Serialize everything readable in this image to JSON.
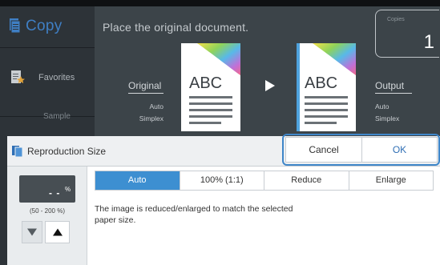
{
  "app": {
    "title": "Copy",
    "favorites_label": "Favorites",
    "sample_label": "Sample"
  },
  "header": {
    "message": "Place the original document."
  },
  "copies": {
    "label": "Copies",
    "value": "1"
  },
  "original": {
    "label": "Original",
    "lines": [
      "Auto",
      "Simplex"
    ],
    "doc_text": "ABC"
  },
  "output": {
    "label": "Output",
    "lines": [
      "Auto",
      "Simplex"
    ],
    "doc_text": "ABC"
  },
  "dialog": {
    "title": "Reproduction Size",
    "cancel_label": "Cancel",
    "ok_label": "OK",
    "percent_value": "- -",
    "percent_unit": "%",
    "range_text": "(50 - 200 %)",
    "tabs": [
      {
        "label": "Auto",
        "active": true
      },
      {
        "label": "100% (1:1)",
        "active": false
      },
      {
        "label": "Reduce",
        "active": false
      },
      {
        "label": "Enlarge",
        "active": false
      }
    ],
    "description": "The image is reduced/enlarged to match the selected paper size."
  },
  "colors": {
    "accent": "#3d8fd1",
    "ok_text": "#2f6fb5",
    "screen_bg": "#3c4449",
    "sidebar_bg": "#2d3338"
  }
}
